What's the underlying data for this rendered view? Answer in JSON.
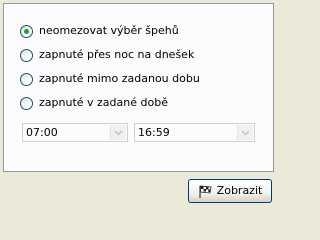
{
  "options": [
    {
      "label": "neomezovat výběr špehů",
      "selected": true
    },
    {
      "label": "zapnuté přes noc na dnešek",
      "selected": false
    },
    {
      "label": "zapnuté mimo zadanou dobu",
      "selected": false
    },
    {
      "label": "zapnuté v zadané době",
      "selected": false
    }
  ],
  "time_from": {
    "value": "07:00",
    "icon": "chevron-down-icon"
  },
  "time_to": {
    "value": "16:59",
    "icon": "chevron-down-icon"
  },
  "show_button": {
    "label": "Zobrazit",
    "icon": "checkered-flag-icon"
  },
  "colors": {
    "selected_dot": "#21a121",
    "panel_border": "#919b9c",
    "button_border": "#003c74"
  }
}
